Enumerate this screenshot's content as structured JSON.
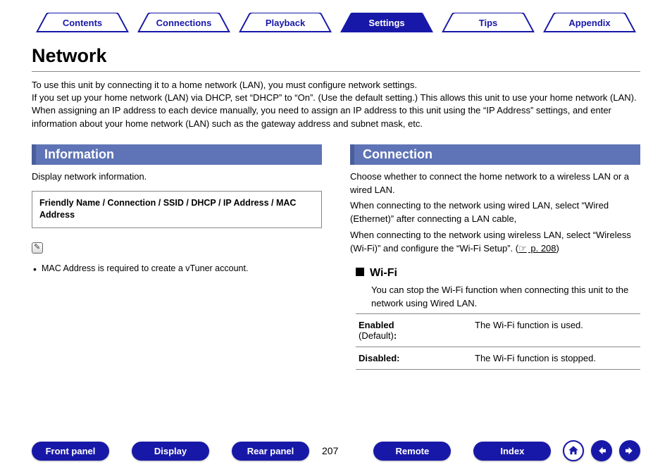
{
  "nav": {
    "tabs": [
      {
        "label": "Contents",
        "active": false
      },
      {
        "label": "Connections",
        "active": false
      },
      {
        "label": "Playback",
        "active": false
      },
      {
        "label": "Settings",
        "active": true
      },
      {
        "label": "Tips",
        "active": false
      },
      {
        "label": "Appendix",
        "active": false
      }
    ]
  },
  "title": "Network",
  "intro": {
    "line1": "To use this unit by connecting it to a home network (LAN), you must configure network settings.",
    "line2": "If you set up your home network (LAN) via DHCP, set “DHCP” to “On”. (Use the default setting.) This allows this unit to use your home network (LAN).",
    "line3": "When assigning an IP address to each device manually, you need to assign an IP address to this unit using the “IP Address” settings, and enter information about your home network (LAN) such as the gateway address and subnet mask, etc."
  },
  "left": {
    "header": "Information",
    "desc": "Display network information.",
    "box": "Friendly Name / Connection / SSID / DHCP / IP Address / MAC Address",
    "note1": "MAC Address is required to create a vTuner account."
  },
  "right": {
    "header": "Connection",
    "p1": "Choose whether to connect the home network to a wireless LAN or a wired LAN.",
    "p2": "When connecting to the network using wired LAN, select “Wired (Ethernet)” after connecting a LAN cable,",
    "p3a": "When connecting to the network using wireless LAN, select “Wireless (Wi-Fi)” and configure the “Wi-Fi Setup”. (",
    "p3link": " p. 208",
    "p3b": ")",
    "wifi": {
      "head": "Wi-Fi",
      "desc": "You can stop the Wi-Fi function when connecting this unit to the network using Wired LAN.",
      "rows": [
        {
          "label": "Enabled",
          "sub": " (Default)",
          "colon": ":",
          "desc": "The Wi-Fi function is used."
        },
        {
          "label": "Disabled:",
          "sub": "",
          "colon": "",
          "desc": "The Wi-Fi function is stopped."
        }
      ]
    }
  },
  "footer": {
    "left": [
      "Front panel",
      "Display",
      "Rear panel"
    ],
    "page": "207",
    "right": [
      "Remote",
      "Index"
    ]
  }
}
